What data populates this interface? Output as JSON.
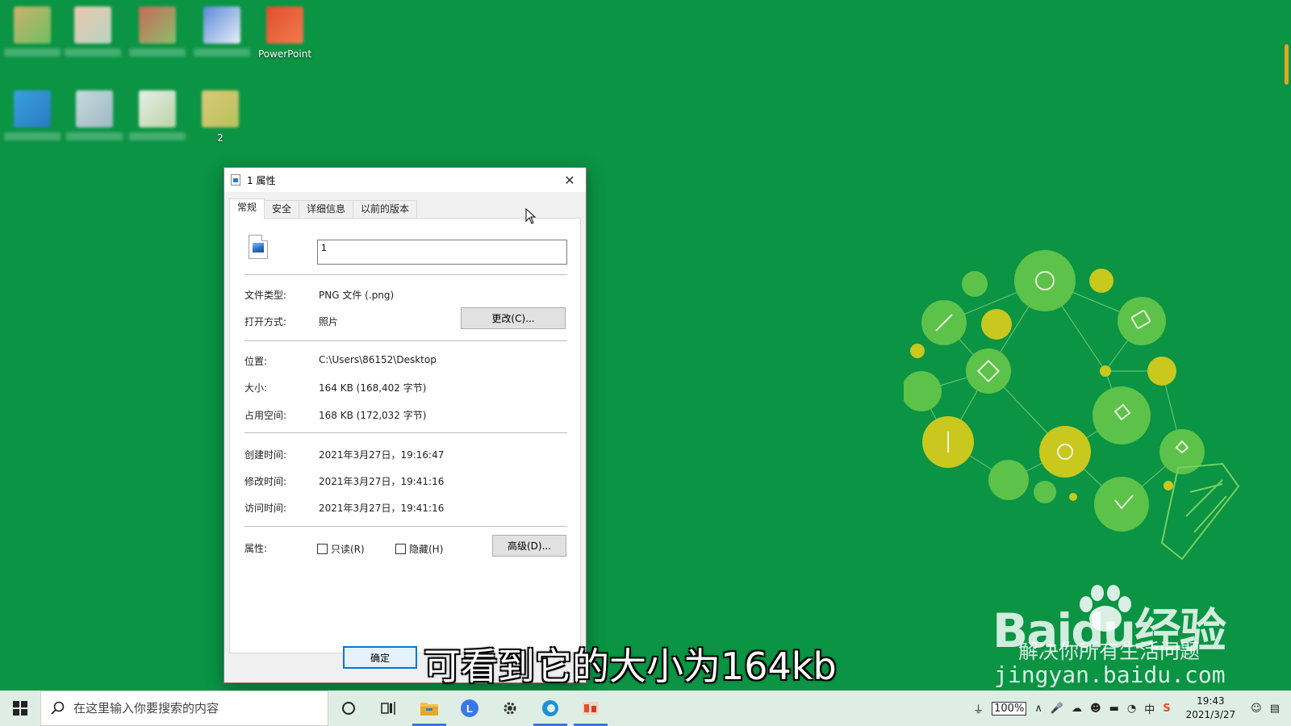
{
  "desktop": {
    "icons": [
      {
        "label": "",
        "colors": [
          "#c9b26a",
          "#6fbf66"
        ]
      },
      {
        "label": "",
        "colors": [
          "#e9c7b0",
          "#b8d4c0"
        ]
      },
      {
        "label": "",
        "colors": [
          "#c86a5a",
          "#8bbf6a"
        ]
      },
      {
        "label": "",
        "colors": [
          "#5b8ad8",
          "#e8eef7"
        ]
      },
      {
        "label": "PowerPoint",
        "colors": [
          "#e0502a",
          "#f07b4f"
        ]
      },
      {
        "label": "",
        "colors": [
          "#3aa0e0",
          "#2a7ac0"
        ]
      },
      {
        "label": "",
        "colors": [
          "#c7d8dd",
          "#9fb9c3"
        ]
      },
      {
        "label": "",
        "colors": [
          "#e8efe8",
          "#b9d3a6"
        ]
      },
      {
        "label": "2",
        "colors": [
          "#dcc77a",
          "#b6c25a"
        ]
      }
    ]
  },
  "dialog": {
    "title": "1 属性",
    "tabs": [
      "常规",
      "安全",
      "详细信息",
      "以前的版本"
    ],
    "file_name": "1",
    "fields": {
      "file_type_label": "文件类型:",
      "file_type_value": "PNG 文件 (.png)",
      "open_with_label": "打开方式:",
      "open_with_value": "照片",
      "change_button": "更改(C)...",
      "location_label": "位置:",
      "location_value": "C:\\Users\\86152\\Desktop",
      "size_label": "大小:",
      "size_value": "164 KB (168,402 字节)",
      "disk_size_label": "占用空间:",
      "disk_size_value": "168 KB (172,032 字节)",
      "created_label": "创建时间:",
      "created_value": "2021年3月27日，19:16:47",
      "modified_label": "修改时间:",
      "modified_value": "2021年3月27日，19:41:16",
      "accessed_label": "访问时间:",
      "accessed_value": "2021年3月27日，19:41:16",
      "attributes_label": "属性:",
      "readonly_label": "只读(R)",
      "hidden_label": "隐藏(H)",
      "advanced_button": "高级(D)..."
    },
    "ok_button": "确定"
  },
  "caption": "可看到它的大小为164kb",
  "watermark": {
    "main": "Baidu经验",
    "slogan": "解决你所有生活问题",
    "url": "jingyan.baidu.com"
  },
  "taskbar": {
    "search_placeholder": "在这里输入你要搜索的内容",
    "battery": "100%",
    "ime": "中",
    "time": "19:43",
    "date": "2021/3/27"
  },
  "colors": {
    "desktop_bg": "#0a9444",
    "accent": "#0078d7"
  }
}
